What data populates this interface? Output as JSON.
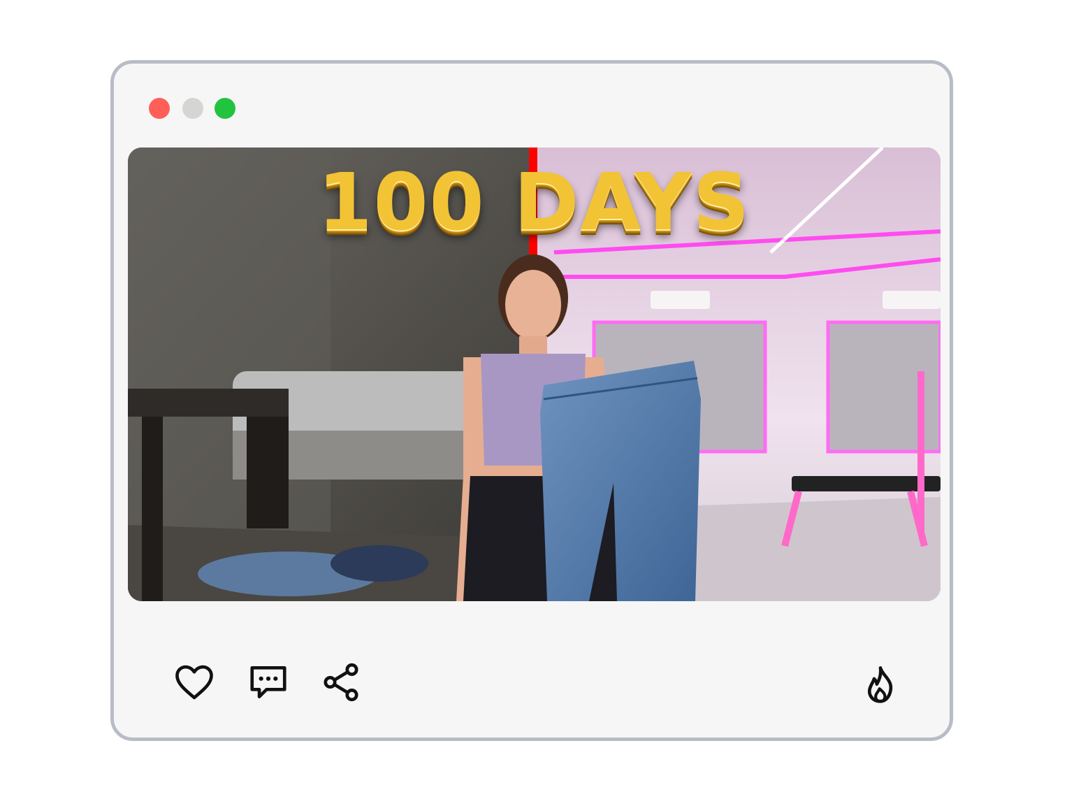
{
  "window": {
    "controls": [
      "close",
      "minimize",
      "maximize"
    ],
    "colors": {
      "close": "#ff5f57",
      "minimize": "#d5d5d3",
      "maximize": "#22c33e"
    }
  },
  "thumbnail": {
    "title": "100 DAYS",
    "title_color": "#f2c335",
    "divider_color": "#ff0000"
  },
  "actions": {
    "icons": [
      "heart-icon",
      "comment-icon",
      "share-icon",
      "fire-icon"
    ]
  }
}
